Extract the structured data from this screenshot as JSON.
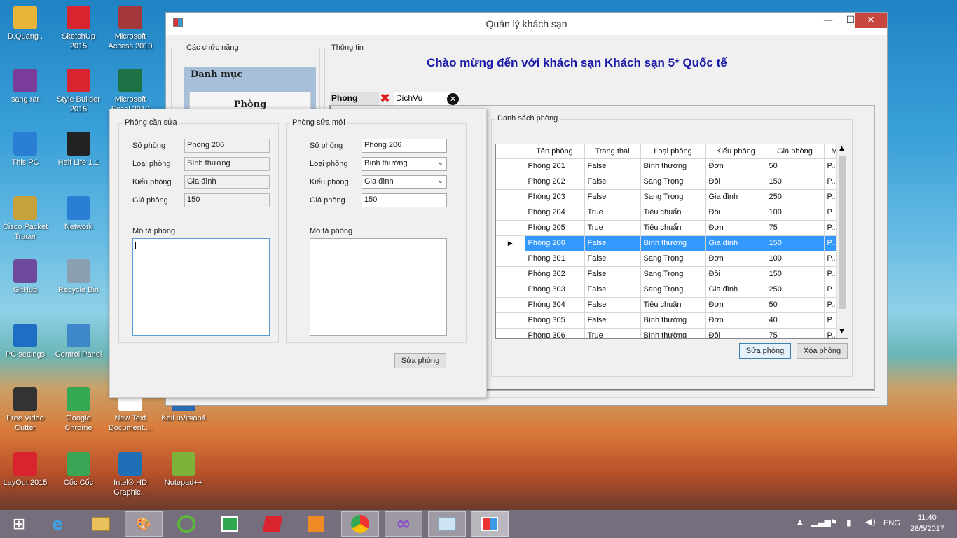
{
  "desktop": {
    "icons": [
      {
        "label": "D.Quang .",
        "icon": "folder-icon",
        "color": "#e8b43a"
      },
      {
        "label": "SketchUp 2015",
        "icon": "sketchup-icon",
        "color": "#d9232e"
      },
      {
        "label": "Microsoft Access 2010",
        "icon": "access-icon",
        "color": "#a4373a"
      },
      {
        "label": "sang.rar",
        "icon": "rar-icon",
        "color": "#7b3b9a"
      },
      {
        "label": "Style Builder 2015",
        "icon": "style-builder-icon",
        "color": "#d9232e"
      },
      {
        "label": "Microsoft Excel 2010",
        "icon": "excel-icon",
        "color": "#1e7145"
      },
      {
        "label": "This PC",
        "icon": "computer-icon",
        "color": "#2a7fd4"
      },
      {
        "label": "Half Life 1.1",
        "icon": "half-life-icon",
        "color": "#222222"
      },
      {
        "label": "Cisco Packet Tracer",
        "icon": "cisco-icon",
        "color": "#c7a23a"
      },
      {
        "label": "Network",
        "icon": "network-icon",
        "color": "#2a7fd4"
      },
      {
        "label": "GitHub",
        "icon": "github-icon",
        "color": "#6e4a9e"
      },
      {
        "label": "Recycle Bin",
        "icon": "recycle-bin-icon",
        "color": "#8aa0b0"
      },
      {
        "label": "PC settings",
        "icon": "gear-icon",
        "color": "#1e6fc4"
      },
      {
        "label": "Control Panel",
        "icon": "control-panel-icon",
        "color": "#3c88c8"
      },
      {
        "label": "Free Video Cutter",
        "icon": "film-icon",
        "color": "#333333"
      },
      {
        "label": "Google Chrome",
        "icon": "chrome-icon",
        "color": "#34a853"
      },
      {
        "label": "New Text Document....",
        "icon": "text-file-icon",
        "color": "#ffffff"
      },
      {
        "label": "Keil uVision4",
        "icon": "keil-icon",
        "color": "#2a6ab0"
      },
      {
        "label": "LayOut 2015",
        "icon": "layout-icon",
        "color": "#d9232e"
      },
      {
        "label": "Cốc Cốc",
        "icon": "coccoc-icon",
        "color": "#3aa655"
      },
      {
        "label": "Intel® HD Graphic...",
        "icon": "intel-icon",
        "color": "#1f6fb6"
      },
      {
        "label": "Notepad++",
        "icon": "notepad-icon",
        "color": "#7fb23a"
      }
    ]
  },
  "main_window": {
    "title": "Quản lý khách sạn",
    "minimize": "—",
    "maximize": "☐",
    "close": "✕",
    "functions_group": "Các chức năng",
    "menu_header": "Danh mục",
    "menu_item": "Phòng",
    "info_group": "Thông tin",
    "welcome": "Chào mừng đến với khách sạn Khách sạn 5* Quốc tế",
    "tabs": [
      {
        "label": "Phong"
      },
      {
        "label": "DichVu"
      }
    ]
  },
  "room_list": {
    "group": "Danh sách phòng",
    "columns": [
      "Tên phòng",
      "Trang thai",
      "Loại phòng",
      "Kiểu phòng",
      "Giá phòng",
      "M"
    ],
    "rows": [
      [
        "Phòng 201",
        "False",
        "Bình thường",
        "Đơn",
        "50",
        "P..."
      ],
      [
        "Phòng 202",
        "False",
        "Sang Trọng",
        "Đôi",
        "150",
        "P..."
      ],
      [
        "Phòng 203",
        "False",
        "Sang Trọng",
        "Gia đình",
        "250",
        "P..."
      ],
      [
        "Phòng 204",
        "True",
        "Tiêu chuẩn",
        "Đôi",
        "100",
        "P..."
      ],
      [
        "Phòng 205",
        "True",
        "Tiêu chuẩn",
        "Đơn",
        "75",
        "P..."
      ],
      [
        "Phòng 206",
        "False",
        "Bình thường",
        "Gia đình",
        "150",
        "P..."
      ],
      [
        "Phòng 301",
        "False",
        "Sang Trọng",
        "Đơn",
        "100",
        "P..."
      ],
      [
        "Phòng 302",
        "False",
        "Sang Trọng",
        "Đôi",
        "150",
        "P..."
      ],
      [
        "Phòng 303",
        "False",
        "Sang Trọng",
        "Gia đình",
        "250",
        "P..."
      ],
      [
        "Phòng 304",
        "False",
        "Tiêu chuẩn",
        "Đơn",
        "50",
        "P..."
      ],
      [
        "Phòng 305",
        "False",
        "Bình thường",
        "Đơn",
        "40",
        "P..."
      ],
      [
        "Phòng 306",
        "True",
        "Bình thường",
        "Đôi",
        "75",
        "P..."
      ]
    ],
    "selected_index": 5,
    "edit_button": "Sửa phòng",
    "delete_button": "Xóa phòng"
  },
  "edit_dialog": {
    "old_group": "Phòng cần sửa",
    "new_group": "Phòng sửa mới",
    "labels": {
      "room_number": "Số phòng",
      "room_type": "Loại phòng",
      "room_style": "Kiểu phòng",
      "room_price": "Giá phòng",
      "description": "Mô tả phòng"
    },
    "old": {
      "room_number": "Phòng 206",
      "room_type": "Bình thường",
      "room_style": "Gia đình",
      "room_price": "150"
    },
    "new": {
      "room_number": "Phòng 206",
      "room_type": "Bình thường",
      "room_style": "Gia đình",
      "room_price": "150"
    },
    "submit": "Sửa phòng"
  },
  "taskbar": {
    "language": "ENG",
    "time": "11:40",
    "date": "28/5/2017"
  }
}
